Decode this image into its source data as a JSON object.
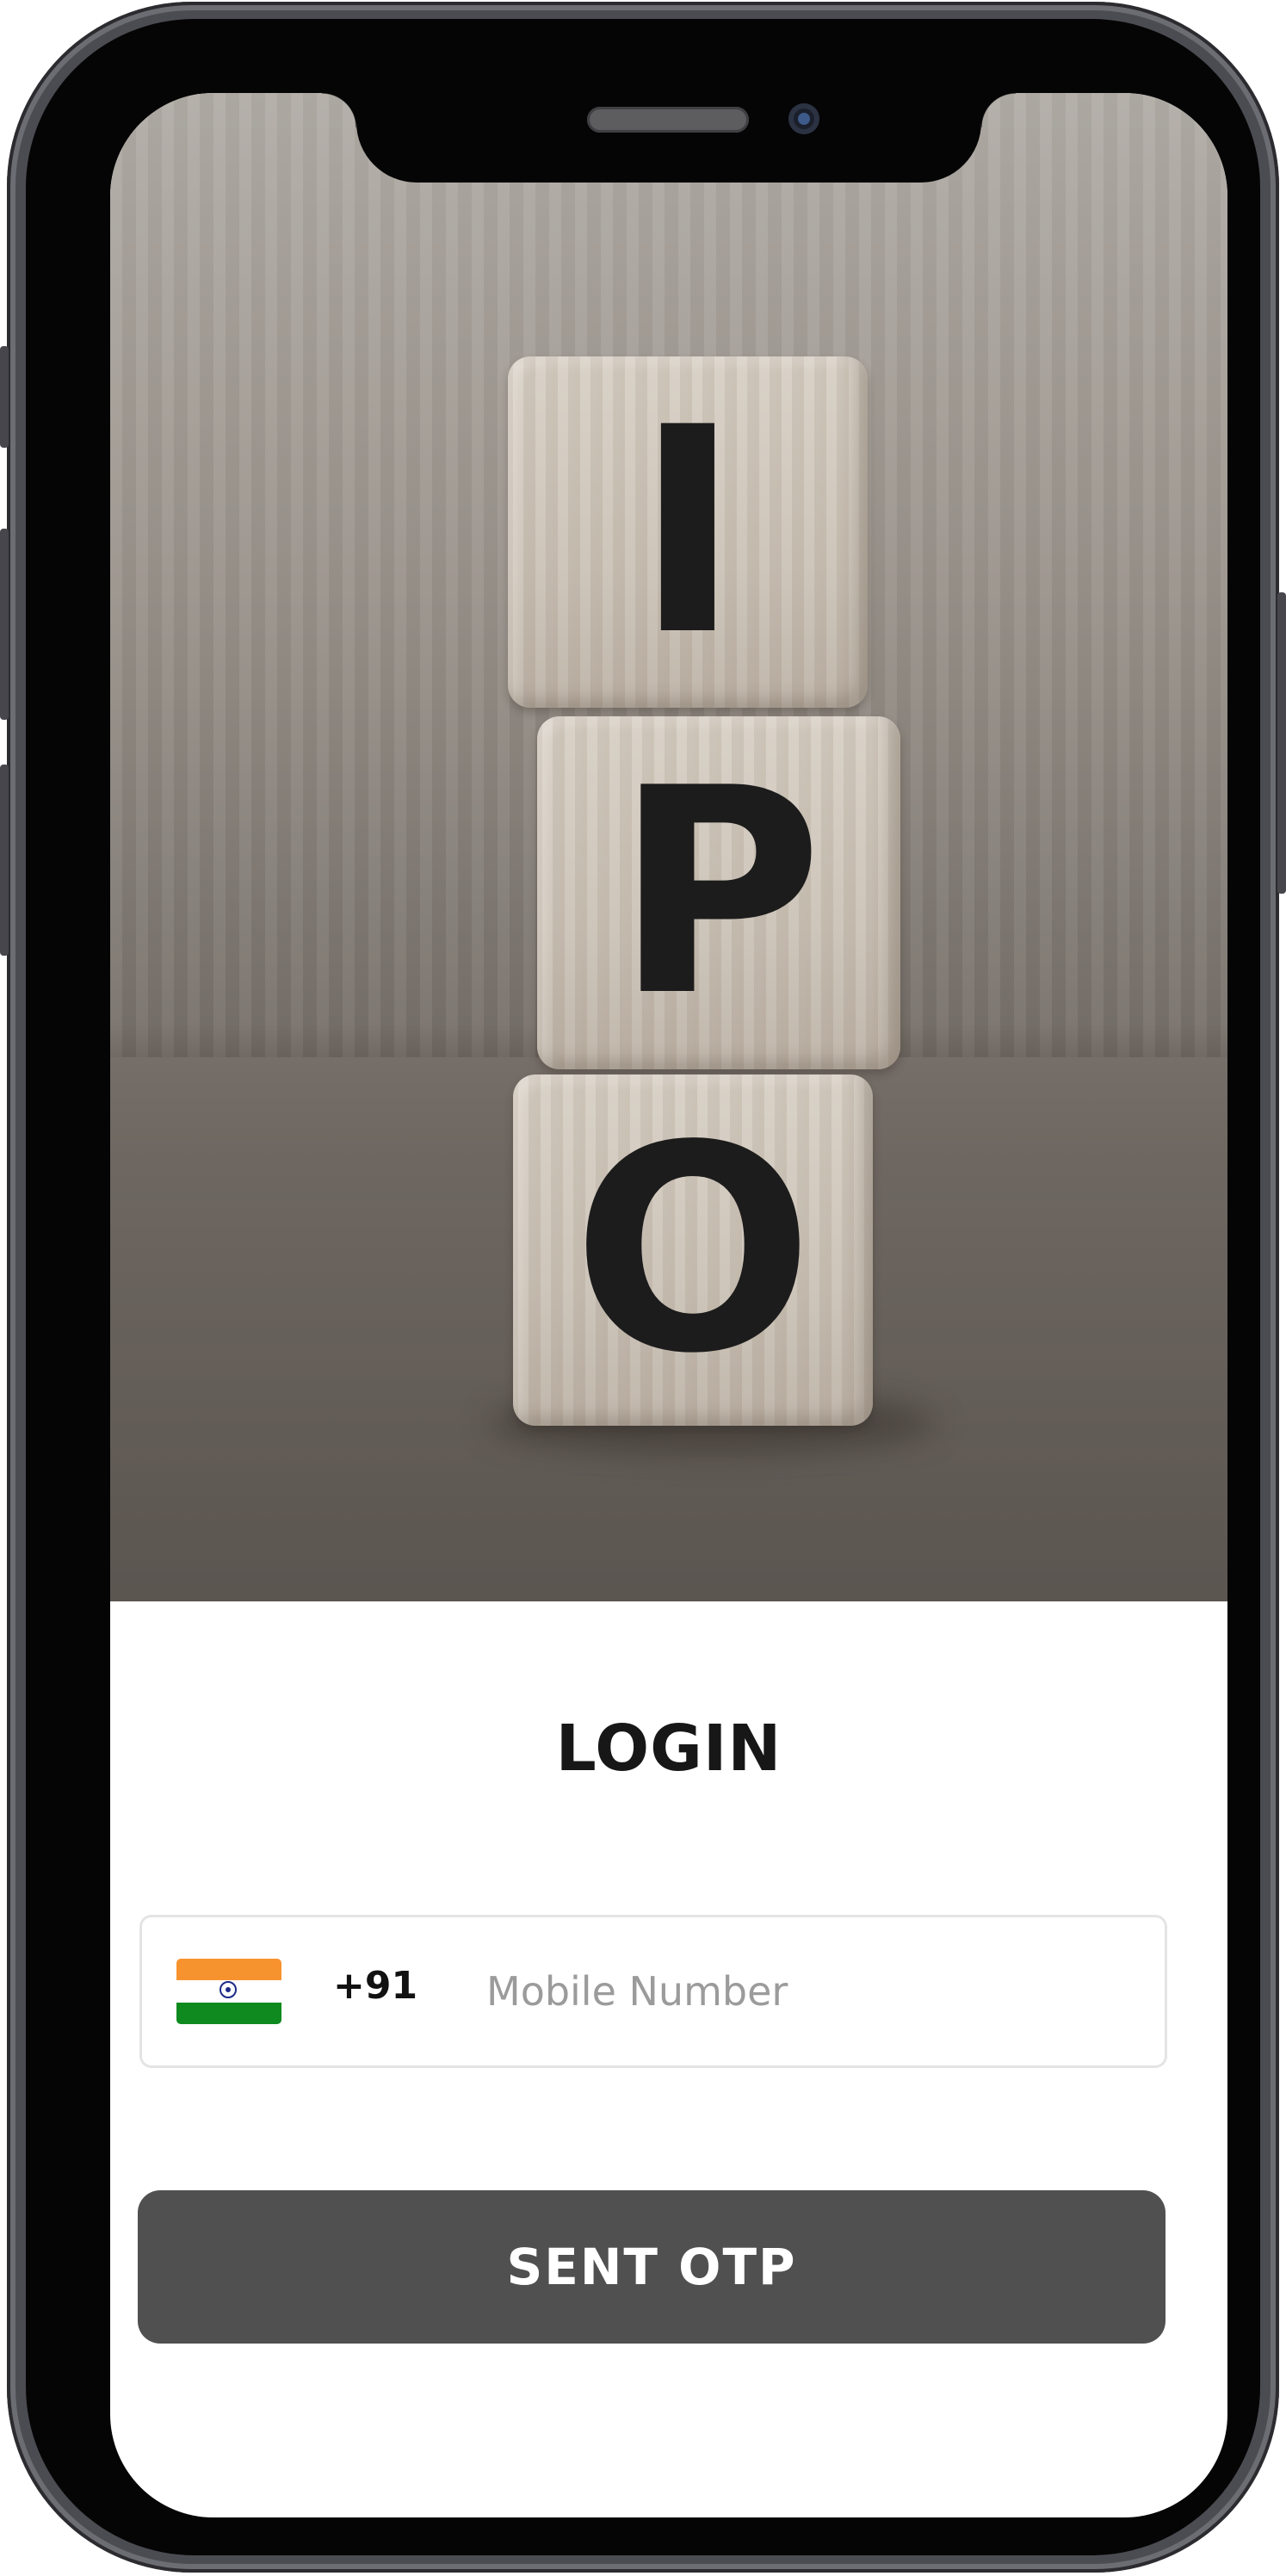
{
  "hero": {
    "image_alt": "Wooden cubes spelling IPO",
    "cube_letters": [
      "I",
      "P",
      "O"
    ]
  },
  "login": {
    "title": "LOGIN",
    "country": {
      "flag_icon": "india-flag-icon",
      "dial_code": "+91"
    },
    "mobile_input": {
      "value": "",
      "placeholder": "Mobile Number"
    },
    "submit_label": "SENT OTP"
  },
  "colors": {
    "button_bg": "#505050",
    "button_text": "#ffffff",
    "title_text": "#171717",
    "placeholder": "#9b9b9b",
    "field_border": "#e4e4e4"
  }
}
